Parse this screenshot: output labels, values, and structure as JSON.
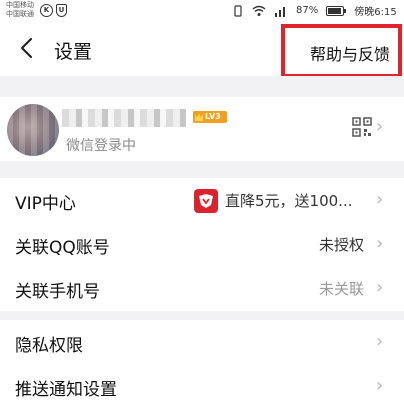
{
  "status_bar": {
    "carrier_line1": "中国移动",
    "carrier_line2": "中国联通",
    "battery": "87%",
    "time": "傍晚6:15"
  },
  "header": {
    "title": "设置",
    "help_label": "帮助与反馈"
  },
  "profile": {
    "level": "LV3",
    "login_status": "微信登录中"
  },
  "rows": {
    "vip": {
      "label": "VIP中心",
      "value": "直降5元，送100..."
    },
    "qq": {
      "label": "关联QQ账号",
      "value": "未授权"
    },
    "phone": {
      "label": "关联手机号",
      "value": "未关联"
    },
    "privacy": {
      "label": "隐私权限"
    },
    "push": {
      "label": "推送通知设置"
    }
  },
  "colors": {
    "highlight": "#e0242e",
    "vip_icon": "#d9232d",
    "level_badge": "#f0a020",
    "section_gap": "#f2f2f4"
  },
  "icons": [
    "back-icon",
    "qr-code-icon",
    "chevron-right-icon",
    "vip-icon",
    "wifi-icon",
    "signal-icon",
    "battery-icon"
  ]
}
